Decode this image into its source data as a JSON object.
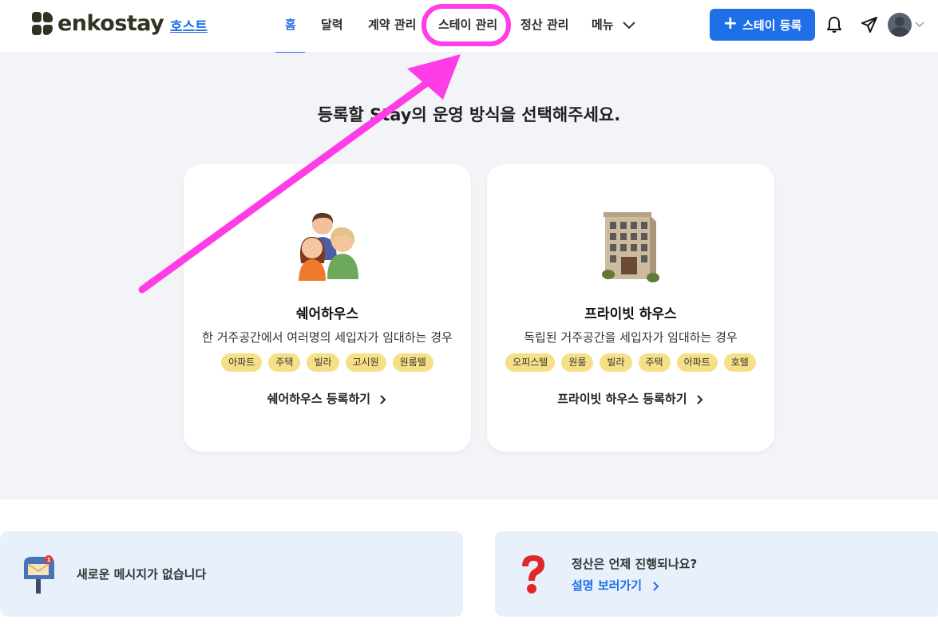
{
  "header": {
    "logo_text": "enkostay",
    "host_label": "호스트",
    "nav": [
      {
        "label": "홈",
        "active": true
      },
      {
        "label": "달력"
      },
      {
        "label": "계약 관리"
      },
      {
        "label": "스테이 관리",
        "highlighted": true
      },
      {
        "label": "정산 관리"
      },
      {
        "label": "메뉴"
      }
    ],
    "register_button": "스테이 등록",
    "icons": [
      "bell-icon",
      "paper-plane-icon",
      "avatar-icon"
    ]
  },
  "hero": {
    "title": "등록할 Stay의 운영 방식을 선택해주세요.",
    "cards": [
      {
        "icon": "people-icon",
        "title": "쉐어하우스",
        "description": "한 거주공간에서 여러명의 세입자가 임대하는 경우",
        "tags": [
          "아파트",
          "주택",
          "빌라",
          "고시원",
          "원룸텔"
        ],
        "link": "쉐어하우스 등록하기"
      },
      {
        "icon": "office-building-icon",
        "title": "프라이빗 하우스",
        "description": "독립된 거주공간을 세입자가 임대하는 경우",
        "tags": [
          "오피스텔",
          "원룸",
          "빌라",
          "주택",
          "아파트",
          "호텔"
        ],
        "link": "프라이빗 하우스 등록하기"
      }
    ]
  },
  "bottom": {
    "messages": {
      "icon": "mailbox-icon",
      "text": "새로운 메시지가 없습니다"
    },
    "faq": {
      "icon": "question-mark-icon",
      "question": "정산은 언제 진행되나요?",
      "link": "설명 보러가기"
    }
  },
  "colors": {
    "accent": "#1f6fe8",
    "annotation": "#ff3ce6",
    "tag": "#f6df87",
    "hero_bg": "#f2f4f8",
    "info_bg": "#e8f0fc"
  }
}
